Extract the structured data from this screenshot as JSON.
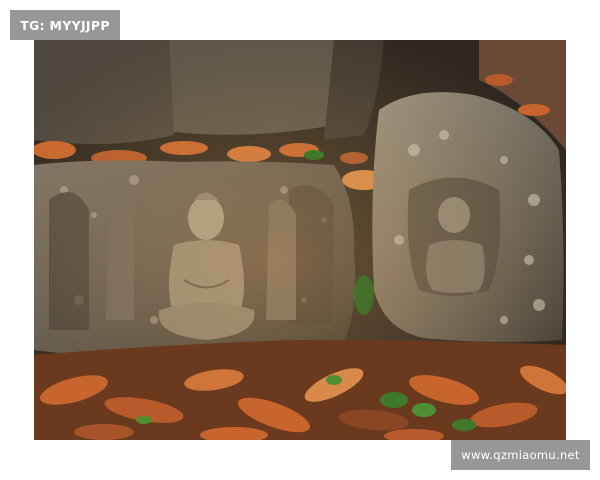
{
  "watermarks": {
    "top_left": "TG: MYYJJPP",
    "bottom_right": "www.qzmiaomu.net"
  },
  "photo": {
    "subject": "seated-buddha-stone-relief",
    "colors": {
      "stone_dark": "#3f3a33",
      "stone_mid": "#6e675b",
      "stone_light": "#a69d8a",
      "lichen": "#c9c4b3",
      "leaf_orange": "#c8652e",
      "leaf_brown": "#8a4522",
      "moss_green": "#3e7a2a",
      "sun_warm": "#e0a45c"
    }
  }
}
